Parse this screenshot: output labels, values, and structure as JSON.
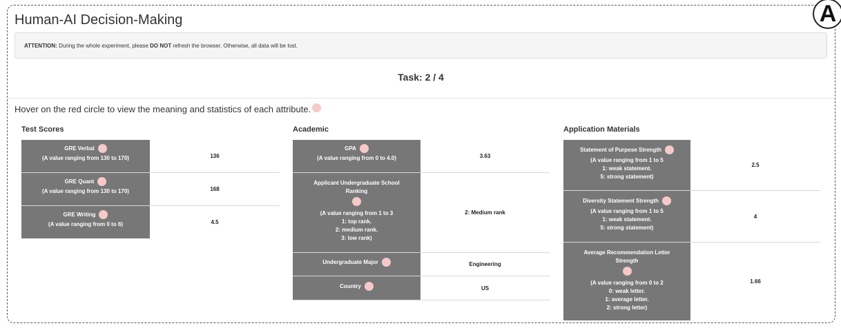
{
  "app": {
    "title": "Human-AI Decision-Making",
    "panel_label": "A"
  },
  "alert": {
    "prefix": "ATTENTION:",
    "text1": " During the whole experiment, please ",
    "emphasis": "DO NOT",
    "text2": " refresh the browser. Otherwise, all data will be lost."
  },
  "task": {
    "label": "Task: 2 / 4"
  },
  "hint": {
    "text": "Hover on the red circle to view the meaning and statistics of each attribute."
  },
  "sections": {
    "test_scores": {
      "title": "Test Scores",
      "rows": [
        {
          "name": "GRE Verbal",
          "desc": "(A value ranging from 130 to 170)",
          "value": "136"
        },
        {
          "name": "GRE Quant",
          "desc": "(A value ranging from 130 to 170)",
          "value": "168"
        },
        {
          "name": "GRE Writing",
          "desc": "(A value ranging from 0 to 6)",
          "value": "4.5"
        }
      ]
    },
    "academic": {
      "title": "Academic",
      "rows": [
        {
          "name": "GPA",
          "desc": "(A value ranging from 0 to 4.0)",
          "value": "3.63"
        },
        {
          "name_line1": "Applicant Undergraduate School",
          "name_line2": "Ranking",
          "desc1": "(A value ranging from 1 to 3",
          "desc2": "1: top rank.",
          "desc3": "2: medium rank.",
          "desc4": "3: low rank)",
          "value": "2: Medium rank"
        },
        {
          "name": "Undergraduate Major",
          "value": "Engineering"
        },
        {
          "name": "Country",
          "value": "US"
        }
      ]
    },
    "application": {
      "title": "Application Materials",
      "rows": [
        {
          "name": "Statement of Purpose Strength",
          "desc1": "(A value ranging from 1 to 5",
          "desc2": "1: weak statement.",
          "desc3": "5: strong statement)",
          "value": "2.5"
        },
        {
          "name": "Diversity Statement Strength",
          "desc1": "(A value ranging from 1 to 5",
          "desc2": "1: weak statement.",
          "desc3": "5: strong statement)",
          "value": "4"
        },
        {
          "name_line1": "Average Recommendation Letter",
          "name_line2": "Strength",
          "desc1": "(A value ranging from 0 to 2",
          "desc2": "0: weak letter.",
          "desc3": "1: average letter.",
          "desc4": "2: strong letter)",
          "value": "1.66"
        }
      ]
    }
  },
  "colors": {
    "attribute_cell": "#777777",
    "info_dot": "#f6c9c9",
    "alert_bg": "#f5f5f5"
  }
}
